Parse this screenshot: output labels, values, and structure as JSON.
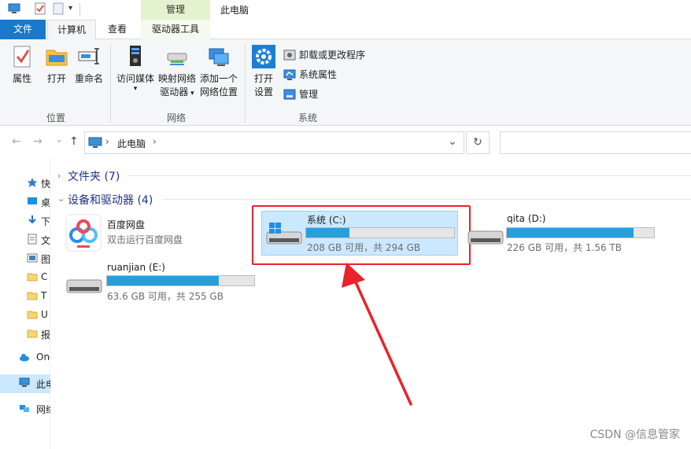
{
  "window": {
    "title": "此电脑",
    "context_tab_group": "管理"
  },
  "ribbon_tabs": {
    "file": "文件",
    "computer": "计算机",
    "view": "查看",
    "drive_tools": "驱动器工具"
  },
  "ribbon": {
    "location": {
      "properties": "属性",
      "open": "打开",
      "rename": "重命名",
      "label": "位置"
    },
    "network": {
      "access_media": "访问媒体",
      "map_drive_1": "映射网络",
      "map_drive_2": "驱动器",
      "add_location_1": "添加一个",
      "add_location_2": "网络位置",
      "label": "网络"
    },
    "system": {
      "open_settings_1": "打开",
      "open_settings_2": "设置",
      "uninstall": "卸载或更改程序",
      "system_properties": "系统属性",
      "manage": "管理",
      "label": "系统"
    }
  },
  "address": {
    "arrow_back": "←",
    "arrow_forward": "→",
    "arrow_recent": "⌄",
    "arrow_up": "↑",
    "path_segment": "此电脑",
    "separator": "›",
    "dropdown": "⌄",
    "refresh": "↻"
  },
  "nav_pane": {
    "items": [
      {
        "label": "快速访问",
        "icon": "star-icon"
      },
      {
        "label": "桌面",
        "icon": "desktop-icon"
      },
      {
        "label": "下载",
        "icon": "download-icon"
      },
      {
        "label": "文档",
        "icon": "document-icon"
      },
      {
        "label": "图片",
        "icon": "picture-icon"
      },
      {
        "label": "C",
        "icon": "folder-icon"
      },
      {
        "label": "T",
        "icon": "folder-icon"
      },
      {
        "label": "U",
        "icon": "folder-icon"
      },
      {
        "label": "报",
        "icon": "folder-icon"
      },
      {
        "label": "OneDrive",
        "icon": "cloud-icon"
      },
      {
        "label": "此电脑",
        "icon": "computer-icon"
      },
      {
        "label": "网络",
        "icon": "network-icon"
      }
    ]
  },
  "content": {
    "folders_header": "文件夹 (7)",
    "devices_header": "设备和驱动器 (4)",
    "baidu": {
      "name": "百度网盘",
      "sub": "双击运行百度网盘"
    },
    "drives": [
      {
        "name": "系统 (C:)",
        "sub": "208 GB 可用，共 294 GB",
        "used_fraction": 0.29,
        "selected": true
      },
      {
        "name": "qita (D:)",
        "sub": "226 GB 可用，共 1.56 TB",
        "used_fraction": 0.86,
        "selected": false
      },
      {
        "name": "ruanjian (E:)",
        "sub": "63.6 GB 可用，共 255 GB",
        "used_fraction": 0.76,
        "selected": false
      }
    ]
  },
  "watermark": "CSDN @信息管家",
  "colors": {
    "accent": "#1979ca",
    "bar": "#26a0da",
    "highlight": "#e8232b",
    "selection": "#cce8ff"
  }
}
